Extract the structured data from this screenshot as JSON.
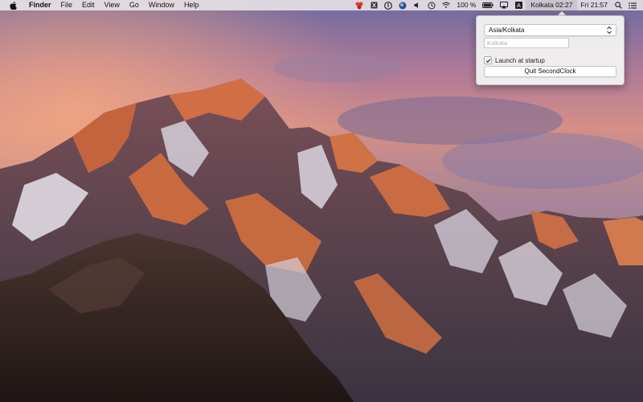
{
  "menubar": {
    "apple_icon": "apple-icon",
    "app_name": "Finder",
    "menus": [
      "File",
      "Edit",
      "View",
      "Go",
      "Window",
      "Help"
    ],
    "status": {
      "battery_percent": "100 %",
      "clock_item": "Kolkata 02:27",
      "datetime": "Fri 21:57"
    }
  },
  "popover": {
    "timezone_selected": "Asia/Kolkata",
    "label_placeholder": "Kolkata",
    "launch_at_startup_label": "Launch at startup",
    "launch_at_startup_checked": true,
    "quit_label": "Quit SecondClock"
  },
  "colors": {
    "menubar_bg": "#ECE8EA",
    "popover_bg": "#F3F1F3"
  }
}
